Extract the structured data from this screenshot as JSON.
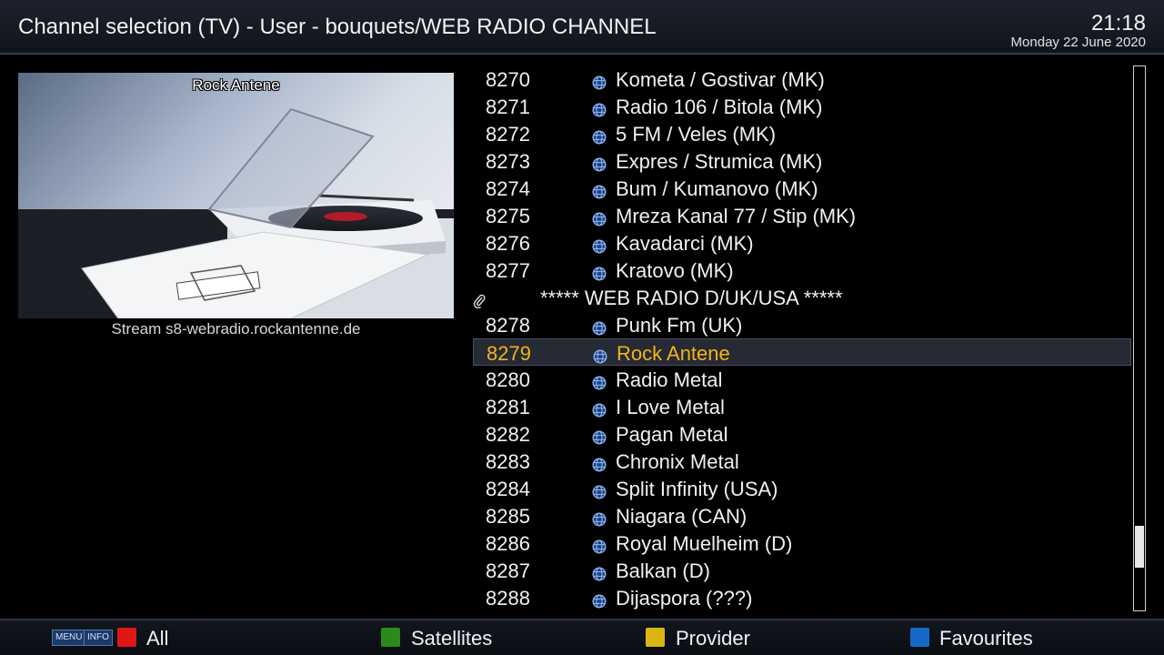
{
  "header": {
    "title": "Channel selection (TV) - User - bouquets/WEB RADIO CHANNEL",
    "time": "21:18",
    "date": "Monday 22 June 2020"
  },
  "preview": {
    "overlay_label": "Rock Antene",
    "stream_label": "Stream s8-webradio.rockantenne.de"
  },
  "channels": [
    {
      "number": "8270",
      "name": "Kometa / Gostivar (MK)",
      "icon": "globe-icon"
    },
    {
      "number": "8271",
      "name": "Radio 106 / Bitola (MK)",
      "icon": "globe-icon"
    },
    {
      "number": "8272",
      "name": "5 FM / Veles (MK)",
      "icon": "globe-icon"
    },
    {
      "number": "8273",
      "name": "Expres / Strumica (MK)",
      "icon": "globe-icon"
    },
    {
      "number": "8274",
      "name": "Bum / Kumanovo (MK)",
      "icon": "globe-icon"
    },
    {
      "number": "8275",
      "name": "Mreza Kanal 77 / Stip (MK)",
      "icon": "globe-icon"
    },
    {
      "number": "8276",
      "name": "Kavadarci (MK)",
      "icon": "globe-icon"
    },
    {
      "number": "8277",
      "name": "Kratovo (MK)",
      "icon": "globe-icon"
    },
    {
      "number": "",
      "name": "***** WEB RADIO D/UK/USA *****",
      "icon": "paperclip-icon",
      "marker": true
    },
    {
      "number": "8278",
      "name": "Punk Fm (UK)",
      "icon": "globe-icon"
    },
    {
      "number": "8279",
      "name": "Rock Antene",
      "icon": "globe-icon",
      "selected": true
    },
    {
      "number": "8280",
      "name": "Radio Metal",
      "icon": "globe-icon"
    },
    {
      "number": "8281",
      "name": "I Love Metal",
      "icon": "globe-icon"
    },
    {
      "number": "8282",
      "name": "Pagan Metal",
      "icon": "globe-icon"
    },
    {
      "number": "8283",
      "name": "Chronix Metal",
      "icon": "globe-icon"
    },
    {
      "number": "8284",
      "name": "Split Infinity (USA)",
      "icon": "globe-icon"
    },
    {
      "number": "8285",
      "name": "Niagara (CAN)",
      "icon": "globe-icon"
    },
    {
      "number": "8286",
      "name": "Royal Muelheim (D)",
      "icon": "globe-icon"
    },
    {
      "number": "8287",
      "name": "Balkan (D)",
      "icon": "globe-icon"
    },
    {
      "number": "8288",
      "name": "Dijaspora (???)",
      "icon": "globe-icon"
    }
  ],
  "footer": {
    "menu_key": "MENU",
    "info_key": "INFO",
    "buttons": [
      {
        "label": "All",
        "color": "#e11616"
      },
      {
        "label": "Satellites",
        "color": "#2c8a1c"
      },
      {
        "label": "Provider",
        "color": "#d9b612"
      },
      {
        "label": "Favourites",
        "color": "#1569c7"
      }
    ]
  },
  "colors": {
    "selected_text": "#f3b319",
    "selected_bg": "#262a35"
  }
}
